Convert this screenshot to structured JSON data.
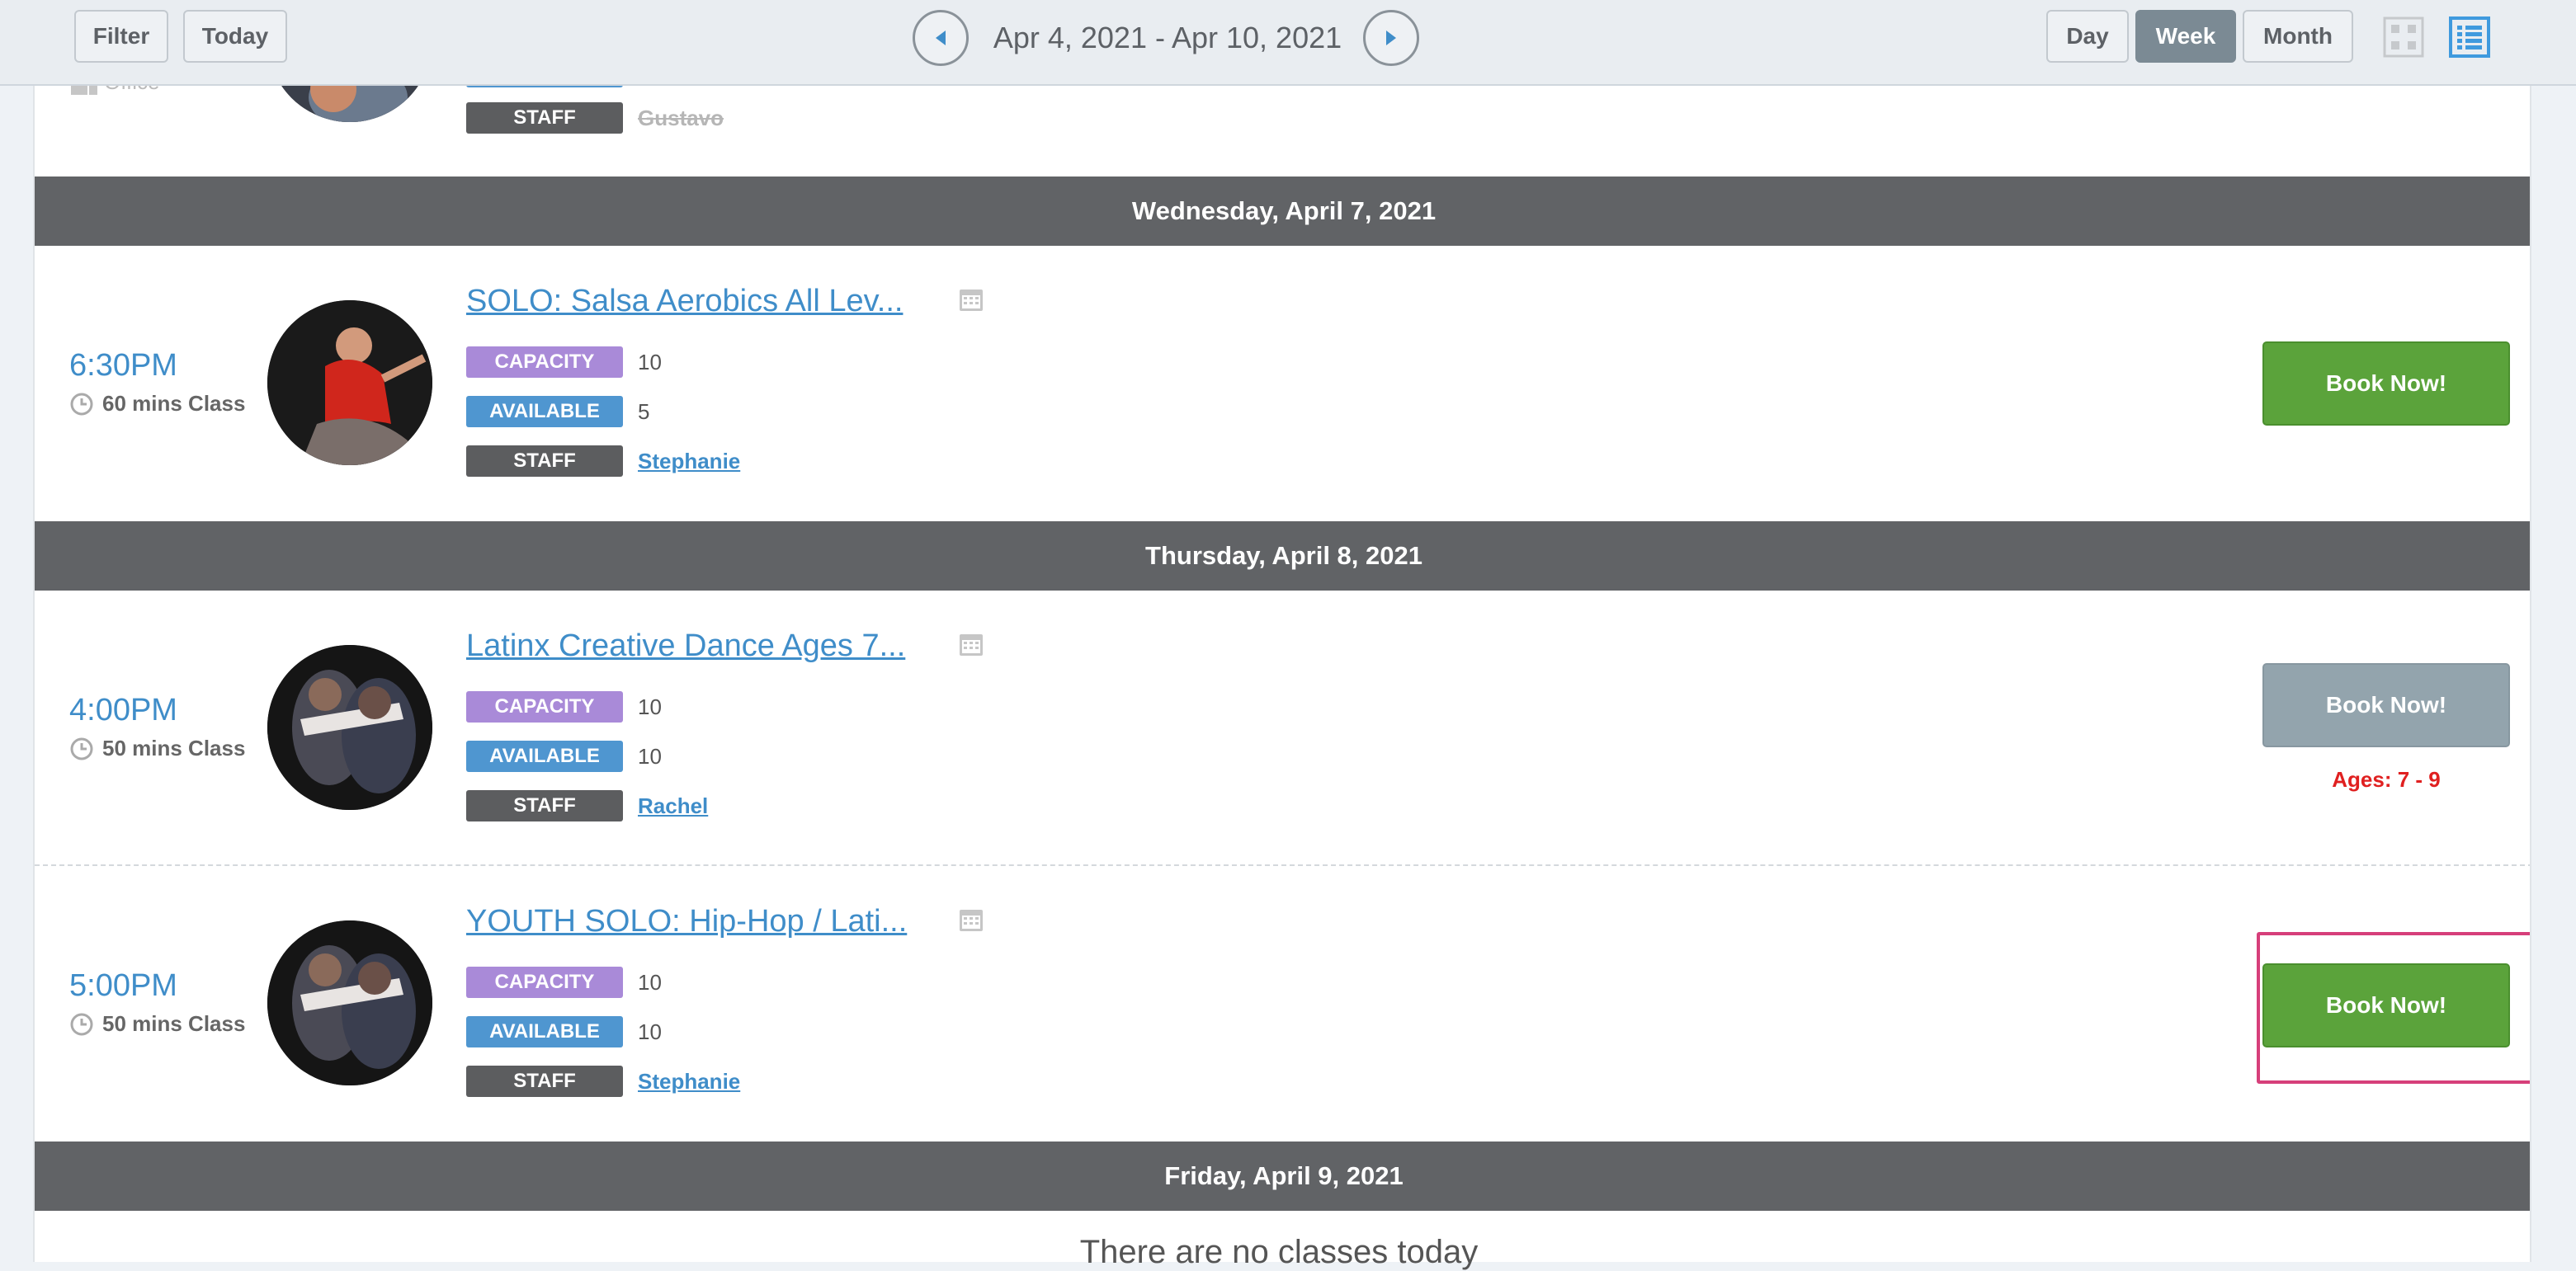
{
  "toolbar": {
    "filter_label": "Filter",
    "today_label": "Today",
    "date_range": "Apr 4, 2021 - Apr 10, 2021",
    "views": [
      {
        "label": "Day",
        "active": false
      },
      {
        "label": "Week",
        "active": true
      },
      {
        "label": "Month",
        "active": false
      }
    ]
  },
  "partial_row": {
    "office_label": "Office",
    "staff_tag": "STAFF",
    "staff_name": "Gustavo"
  },
  "days": [
    {
      "header": "Wednesday, April 7, 2021",
      "classes": [
        {
          "time": "6:30PM",
          "duration": "60 mins Class",
          "title": "SOLO: Salsa Aerobics All Lev...",
          "capacity_label": "CAPACITY",
          "capacity": "10",
          "available_label": "AVAILABLE",
          "available": "5",
          "staff_label": "STAFF",
          "staff": "Stephanie",
          "book_label": "Book Now!"
        }
      ]
    },
    {
      "header": "Thursday, April 8, 2021",
      "classes": [
        {
          "time": "4:00PM",
          "duration": "50 mins Class",
          "title": "Latinx Creative Dance Ages 7...",
          "capacity_label": "CAPACITY",
          "capacity": "10",
          "available_label": "AVAILABLE",
          "available": "10",
          "staff_label": "STAFF",
          "staff": "Rachel",
          "book_label": "Book Now!",
          "restriction": "Ages: 7 - 9"
        },
        {
          "time": "5:00PM",
          "duration": "50 mins Class",
          "title": "YOUTH SOLO: Hip-Hop / Lati...",
          "capacity_label": "CAPACITY",
          "capacity": "10",
          "available_label": "AVAILABLE",
          "available": "10",
          "staff_label": "STAFF",
          "staff": "Stephanie",
          "book_label": "Book Now!"
        }
      ]
    },
    {
      "header": "Friday, April 9, 2021",
      "empty_message": "There are no classes today"
    }
  ],
  "colors": {
    "accent_blue": "#3f8dc9",
    "book_green": "#5ba33b",
    "book_disabled": "#93a4ad",
    "day_header": "#616366",
    "capacity_tag": "#a98ad8",
    "available_tag": "#4f96d0",
    "staff_tag": "#5c5d5f",
    "restriction_red": "#e02020",
    "highlight_pink": "#d63f7a"
  }
}
